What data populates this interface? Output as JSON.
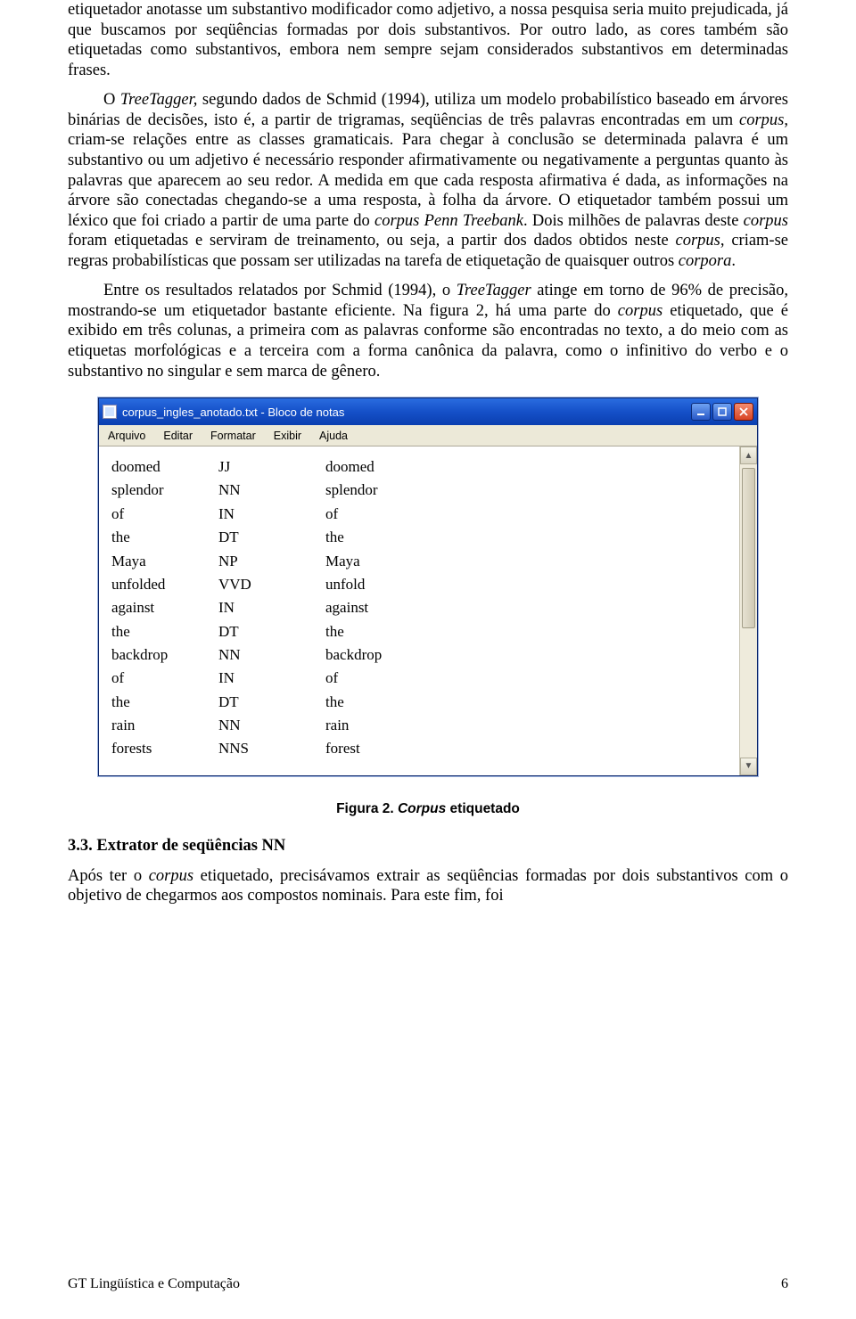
{
  "paragraphs": {
    "p1": "etiquetador anotasse um substantivo modificador como adjetivo, a nossa pesquisa seria muito prejudicada, já que buscamos por seqüências formadas por dois substantivos. Por outro lado, as cores também são etiquetadas como substantivos, embora nem sempre sejam considerados substantivos em determinadas frases.",
    "p2a": "O ",
    "p2b": "TreeTagger,",
    "p2c": " segundo dados de Schmid (1994), utiliza um modelo probabilístico baseado em árvores binárias de decisões, isto é, a partir de trigramas, seqüências de três palavras encontradas em um ",
    "p2d": "corpus",
    "p2e": ", criam-se relações entre as classes gramaticais. Para chegar à conclusão se determinada palavra é um substantivo ou um adjetivo é necessário responder afirmativamente ou negativamente a perguntas quanto às palavras que aparecem ao seu redor. A medida em que cada resposta afirmativa é dada, as informações na árvore são conectadas chegando-se a uma resposta, à folha da árvore. O etiquetador também possui um léxico que foi criado a partir de uma parte do ",
    "p2f": "corpus Penn Treebank",
    "p2g": ". Dois milhões de palavras deste ",
    "p2h": "corpus",
    "p2i": " foram etiquetadas e serviram de treinamento, ou seja, a partir dos dados obtidos neste ",
    "p2j": "corpus",
    "p2k": ", criam-se regras probabilísticas que possam ser utilizadas na tarefa de etiquetação de quaisquer outros ",
    "p2l": "corpora",
    "p2m": ".",
    "p3a": "Entre os resultados relatados por Schmid (1994), o ",
    "p3b": "TreeTagger",
    "p3c": " atinge em torno de 96% de precisão, mostrando-se um etiquetador bastante eficiente. Na figura 2, há uma parte do ",
    "p3d": "corpus",
    "p3e": " etiquetado, que é exibido em três colunas, a primeira com as palavras conforme são encontradas no texto, a do meio com as etiquetas morfológicas e a terceira com a forma canônica da palavra, como o infinitivo do verbo e o substantivo no singular e sem marca de gênero.",
    "p4a": "Após ter o ",
    "p4b": "corpus",
    "p4c": " etiquetado, precisávamos extrair as seqüências formadas por dois substantivos com o objetivo de chegarmos aos compostos nominais. Para este fim, foi"
  },
  "notepad": {
    "title": "corpus_ingles_anotado.txt - Bloco de notas",
    "menu": [
      "Arquivo",
      "Editar",
      "Formatar",
      "Exibir",
      "Ajuda"
    ],
    "rows": [
      {
        "c1": "doomed",
        "c2": "JJ",
        "c3": "doomed"
      },
      {
        "c1": "splendor",
        "c2": "NN",
        "c3": "splendor"
      },
      {
        "c1": "of",
        "c2": "IN",
        "c3": "of"
      },
      {
        "c1": "the",
        "c2": "DT",
        "c3": "the"
      },
      {
        "c1": "Maya",
        "c2": "NP",
        "c3": "Maya"
      },
      {
        "c1": "unfolded",
        "c2": "VVD",
        "c3": "unfold"
      },
      {
        "c1": "against",
        "c2": "IN",
        "c3": "against"
      },
      {
        "c1": "the",
        "c2": "DT",
        "c3": "the"
      },
      {
        "c1": "backdrop",
        "c2": "NN",
        "c3": "backdrop"
      },
      {
        "c1": "of",
        "c2": "IN",
        "c3": "of"
      },
      {
        "c1": "the",
        "c2": "DT",
        "c3": "the"
      },
      {
        "c1": "rain",
        "c2": "NN",
        "c3": "rain"
      },
      {
        "c1": "forests",
        "c2": "NNS",
        "c3": "forest"
      }
    ]
  },
  "figure_caption": {
    "a": "Figura 2. ",
    "b": "Corpus",
    "c": " etiquetado"
  },
  "section_heading": "3.3. Extrator de seqüências NN",
  "footer": {
    "left": "GT Lingüística e Computação",
    "right": "6"
  }
}
